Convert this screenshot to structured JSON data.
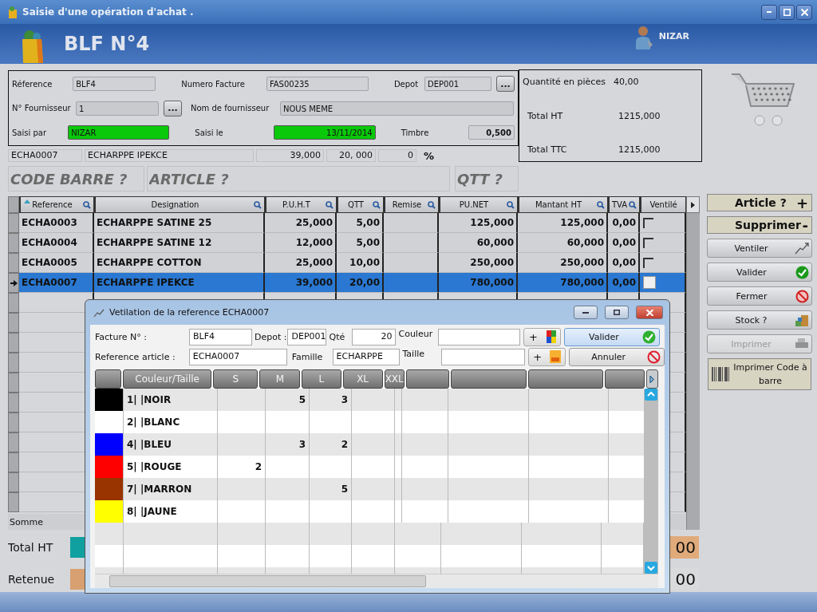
{
  "window": {
    "title": "Saisie d'une opération d'achat ."
  },
  "header": {
    "title": "BLF N°4",
    "user": "NIZAR"
  },
  "form": {
    "reference": {
      "label": "Réference",
      "value": "BLF4"
    },
    "numero_facture": {
      "label": "Numero Facture",
      "value": "FAS00235"
    },
    "depot": {
      "label": "Depot",
      "value": "DEP001",
      "browse": "..."
    },
    "fournisseur": {
      "label": "N° Fournisseur",
      "value": "1",
      "browse": "..."
    },
    "nom_fournisseur": {
      "label": "Nom de fournisseur",
      "value": "NOUS MEME"
    },
    "saisi_par": {
      "label": "Saisi par",
      "value": "NIZAR"
    },
    "saisi_le": {
      "label": "Saisi le",
      "value": "13/11/2014"
    },
    "timbre": {
      "label": "Timbre",
      "value": "0,500"
    }
  },
  "totals": [
    {
      "label": "Quantité en pièces",
      "value": "40,00"
    },
    {
      "label": "Total HT",
      "value": "1215,000"
    },
    {
      "label": "Total TTC",
      "value": "1215,000"
    }
  ],
  "line_entry": {
    "values": [
      "ECHA0007",
      "ECHARPPE IPEKCE",
      "39,000",
      "20, 000",
      "0"
    ],
    "unit": "%"
  },
  "search": [
    {
      "placeholder": "CODE BARRE ?"
    },
    {
      "placeholder": "ARTICLE ?"
    },
    {
      "placeholder": "QTT ?"
    }
  ],
  "table": {
    "columns": [
      {
        "label": "Reference",
        "sorted": true
      },
      {
        "label": "Designation",
        "sorted": false
      },
      {
        "label": "P.U.H.T",
        "sorted": false
      },
      {
        "label": "QTT",
        "sorted": false
      },
      {
        "label": "Remise",
        "sorted": false
      },
      {
        "label": "PU.NET",
        "sorted": false
      },
      {
        "label": "Mantant HT",
        "sorted": false
      },
      {
        "label": "TVA",
        "sorted": false
      },
      {
        "label": "Ventilé",
        "sorted": false
      }
    ],
    "rows": [
      {
        "cells": [
          "ECHA0003",
          "ECHARPPE SATINE 25",
          "25,000",
          "5,00",
          "",
          "125,000",
          "125,000",
          "0,00"
        ],
        "checked": false,
        "selected": false
      },
      {
        "cells": [
          "ECHA0004",
          "ECHARPPE SATINE 12",
          "12,000",
          "5,00",
          "",
          "60,000",
          "60,000",
          "0,00"
        ],
        "checked": false,
        "selected": false
      },
      {
        "cells": [
          "ECHA0005",
          "ECHARPPE COTTON",
          "25,000",
          "10,00",
          "",
          "250,000",
          "250,000",
          "0,00"
        ],
        "checked": false,
        "selected": false
      },
      {
        "cells": [
          "ECHA0007",
          "ECHARPPE IPEKCE",
          "39,000",
          "20,00",
          "",
          "780,000",
          "780,000",
          "0,00"
        ],
        "checked": false,
        "selected": true
      }
    ],
    "footer": "Somme"
  },
  "actions": [
    {
      "label": "Article ?",
      "kind": "add",
      "sign": "+",
      "disabled": false
    },
    {
      "label": "Supprimer",
      "kind": "remove",
      "sign": "-",
      "disabled": false
    },
    {
      "label": "Ventiler",
      "kind": "ventilate",
      "disabled": false
    },
    {
      "label": "Valider",
      "kind": "validate",
      "disabled": false
    },
    {
      "label": "Fermer",
      "kind": "close",
      "disabled": false
    },
    {
      "label": "Stock ?",
      "kind": "stock",
      "disabled": false
    },
    {
      "label": "Imprimer",
      "kind": "print",
      "disabled": true
    },
    {
      "label": "Imprimer Code à barre",
      "kind": "barcode",
      "disabled": false
    }
  ],
  "bottom": [
    {
      "label": "Total HT",
      "value": "00"
    },
    {
      "label": "Retenue",
      "value": "00"
    }
  ],
  "dialog": {
    "title": "Vetilation de la reference ECHA0007",
    "facture": {
      "label": "Facture N° :",
      "value": "BLF4"
    },
    "depot": {
      "label": "Depot :",
      "value": "DEP001"
    },
    "qte": {
      "label": "Qté",
      "value": "20"
    },
    "couleur": {
      "label": "Couleur",
      "add": "+"
    },
    "reference": {
      "label": "Reference article :",
      "value": "ECHA0007"
    },
    "famille": {
      "label": "Famille",
      "value": "ECHARPPE"
    },
    "taille": {
      "label": "Taille",
      "add": "+"
    },
    "buttons": [
      {
        "label": "Valider",
        "kind": "ok",
        "selected": true
      },
      {
        "label": "Annuler",
        "kind": "cancel",
        "selected": false
      }
    ],
    "grid": {
      "columns": [
        "Couleur/Taille",
        "S",
        "M",
        "L",
        "XL",
        "XXL"
      ],
      "rows": [
        {
          "color": "#000000",
          "cells": [
            "1| |NOIR",
            "",
            "5",
            "3",
            "",
            ""
          ]
        },
        {
          "color": "#ffffff",
          "cells": [
            "2| |BLANC",
            "",
            "",
            "",
            "",
            ""
          ]
        },
        {
          "color": "#0000ff",
          "cells": [
            "4| |BLEU",
            "",
            "3",
            "2",
            "",
            ""
          ]
        },
        {
          "color": "#ff0000",
          "cells": [
            "5| |ROUGE",
            "2",
            "",
            "",
            "",
            ""
          ]
        },
        {
          "color": "#993300",
          "cells": [
            "7| |MARRON",
            "",
            "",
            "5",
            "",
            ""
          ]
        },
        {
          "color": "#ffff00",
          "cells": [
            "8| |JAUNE",
            "",
            "",
            "",
            "",
            ""
          ]
        }
      ]
    }
  }
}
